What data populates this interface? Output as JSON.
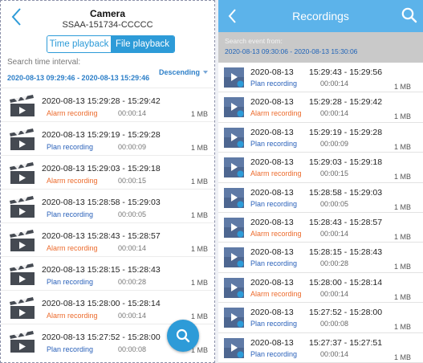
{
  "left": {
    "header": {
      "title": "Camera",
      "subtitle": "SSAA-151734-CCCCC"
    },
    "segment": {
      "time_playback": "Time playback",
      "file_playback": "File playback"
    },
    "search": {
      "label": "Search time interval:",
      "value": "2020-08-13 09:29:46 - 2020-08-13 15:29:46"
    },
    "sort": {
      "label": "Descending"
    },
    "items": [
      {
        "time": "2020-08-13  15:29:28 - 15:29:42",
        "type": "Alarm recording",
        "duration": "00:00:14",
        "size": "1 MB"
      },
      {
        "time": "2020-08-13  15:29:19 - 15:29:28",
        "type": "Plan recording",
        "duration": "00:00:09",
        "size": "1 MB"
      },
      {
        "time": "2020-08-13  15:29:03 - 15:29:18",
        "type": "Alarm recording",
        "duration": "00:00:15",
        "size": "1 MB"
      },
      {
        "time": "2020-08-13  15:28:58 - 15:29:03",
        "type": "Plan recording",
        "duration": "00:00:05",
        "size": "1 MB"
      },
      {
        "time": "2020-08-13  15:28:43 - 15:28:57",
        "type": "Alarm recording",
        "duration": "00:00:14",
        "size": "1 MB"
      },
      {
        "time": "2020-08-13  15:28:15 - 15:28:43",
        "type": "Plan recording",
        "duration": "00:00:28",
        "size": "1 MB"
      },
      {
        "time": "2020-08-13  15:28:00 - 15:28:14",
        "type": "Alarm recording",
        "duration": "00:00:14",
        "size": "1 MB"
      },
      {
        "time": "2020-08-13  15:27:52 - 15:28:00",
        "type": "Plan recording",
        "duration": "00:00:08",
        "size": "1 MB"
      }
    ]
  },
  "right": {
    "header": {
      "title": "Recordings"
    },
    "search": {
      "label": "Search event from:",
      "value": "2020-08-13 09:30:06 - 2020-08-13 15:30:06"
    },
    "items": [
      {
        "date": "2020-08-13",
        "range": "15:29:43 - 15:29:56",
        "type": "Plan recording",
        "duration": "00:00:14",
        "size": "1 MB"
      },
      {
        "date": "2020-08-13",
        "range": "15:29:28 - 15:29:42",
        "type": "Alarm recording",
        "duration": "00:00:14",
        "size": "1 MB"
      },
      {
        "date": "2020-08-13",
        "range": "15:29:19 - 15:29:28",
        "type": "Plan recording",
        "duration": "00:00:09",
        "size": "1 MB"
      },
      {
        "date": "2020-08-13",
        "range": "15:29:03 - 15:29:18",
        "type": "Alarm recording",
        "duration": "00:00:15",
        "size": "1 MB"
      },
      {
        "date": "2020-08-13",
        "range": "15:28:58 - 15:29:03",
        "type": "Plan recording",
        "duration": "00:00:05",
        "size": "1 MB"
      },
      {
        "date": "2020-08-13",
        "range": "15:28:43 - 15:28:57",
        "type": "Alarm recording",
        "duration": "00:00:14",
        "size": "1 MB"
      },
      {
        "date": "2020-08-13",
        "range": "15:28:15 - 15:28:43",
        "type": "Plan recording",
        "duration": "00:00:28",
        "size": "1 MB"
      },
      {
        "date": "2020-08-13",
        "range": "15:28:00 - 15:28:14",
        "type": "Alarm recording",
        "duration": "00:00:14",
        "size": "1 MB"
      },
      {
        "date": "2020-08-13",
        "range": "15:27:52 - 15:28:00",
        "type": "Plan recording",
        "duration": "00:00:08",
        "size": "1 MB"
      },
      {
        "date": "2020-08-13",
        "range": "15:27:37 - 15:27:51",
        "type": "Plan recording",
        "duration": "00:00:14",
        "size": "1 MB"
      }
    ]
  },
  "colors": {
    "accent": "#2d9bd8",
    "header_blue": "#5cb3ea",
    "alarm": "#ec6b2d",
    "plan": "#2b62ba"
  },
  "icons": {
    "back": "chevron-left-icon",
    "search": "search-icon",
    "clapperboard": "clapperboard-icon",
    "video_thumb": "video-thumbnail-icon"
  }
}
